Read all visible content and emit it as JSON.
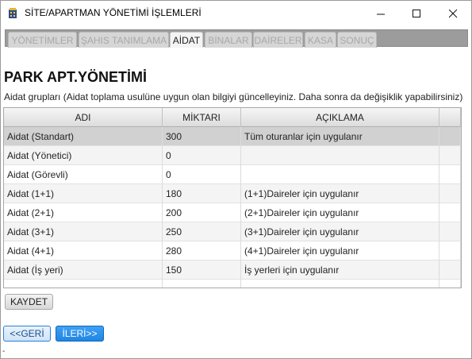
{
  "window": {
    "title": "SİTE/APARTMAN YÖNETİMİ İŞLEMLERİ",
    "minimize": "—",
    "maximize": "☐",
    "close": "✕"
  },
  "tabs": [
    {
      "label": "YÖNETİMLER",
      "active": false
    },
    {
      "label": "ŞAHIS TANIMLAMA",
      "active": false
    },
    {
      "label": "AİDAT",
      "active": true
    },
    {
      "label": "BİNALAR",
      "active": false
    },
    {
      "label": "DAİRELER",
      "active": false
    },
    {
      "label": "KASA",
      "active": false
    },
    {
      "label": "SONUÇ",
      "active": false
    }
  ],
  "page": {
    "heading": "PARK APT.YÖNETİMİ",
    "subtitle": "Aidat grupları (Aidat toplama usulüne uygun olan bilgiyi güncelleyiniz. Daha sonra da değişiklik yapabilirsiniz)"
  },
  "table": {
    "headers": [
      "ADI",
      "MİKTARI",
      "AÇIKLAMA",
      ""
    ],
    "rows": [
      {
        "name": "Aidat  (Standart)",
        "amount": "300",
        "desc": "Tüm oturanlar için uygulanır"
      },
      {
        "name": "Aidat  (Yönetici)",
        "amount": "0",
        "desc": ""
      },
      {
        "name": "Aidat  (Görevli)",
        "amount": "0",
        "desc": ""
      },
      {
        "name": "Aidat  (1+1)",
        "amount": "180",
        "desc": "(1+1)Daireler için uygulanır"
      },
      {
        "name": "Aidat  (2+1)",
        "amount": "200",
        "desc": "(2+1)Daireler için uygulanır"
      },
      {
        "name": "Aidat  (3+1)",
        "amount": "250",
        "desc": "(3+1)Daireler için uygulanır"
      },
      {
        "name": "Aidat  (4+1)",
        "amount": "280",
        "desc": "(4+1)Daireler için uygulanır"
      },
      {
        "name": "Aidat  (İş yeri)",
        "amount": "150",
        "desc": "İş yerleri için uygulanır"
      }
    ]
  },
  "buttons": {
    "save": "KAYDET",
    "back": "<<GERİ",
    "next": "İLERİ>>"
  },
  "footer": {
    "dash": "-"
  },
  "colors": {
    "tabstrip": "#9c9c9c",
    "selected_row": "#d1d1d1",
    "next_button": "#1f86e3"
  }
}
